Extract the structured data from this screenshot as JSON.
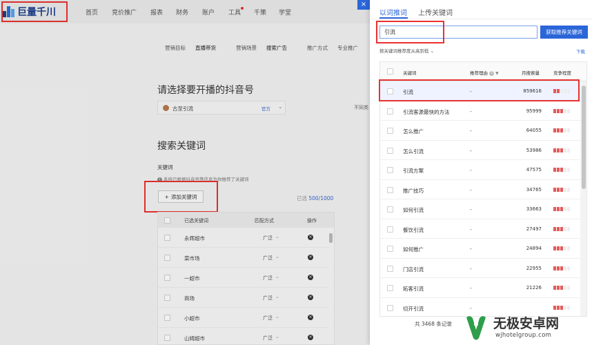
{
  "app": {
    "brand": "巨量千川",
    "nav": [
      "首页",
      "竞价推广",
      "报表",
      "财务",
      "账户",
      "工具",
      "千策",
      "学堂"
    ]
  },
  "subtabs": [
    "营销目标",
    "直播带货",
    "营销场景",
    "搜索广告",
    "推广方式",
    "专业推广"
  ],
  "main": {
    "select_account_title": "请选择要开播的抖音号",
    "account_name": "古至引流",
    "account_badge": "官方",
    "side_text": "不同类",
    "search_kw_title": "搜索关键词",
    "kw_label": "关键词",
    "kw_tip": "系统已根据抖音号等信息为你推荐了关键词",
    "add_kw_button": "添加关键词",
    "add_kw_plus": "+",
    "selected_prefix": "已选",
    "selected_value": "500/1000",
    "table_headers": {
      "keyword": "已选关键词",
      "match": "匹配方式",
      "action": "操作"
    },
    "rows": [
      {
        "kw": "永辉超市",
        "match": "广泛"
      },
      {
        "kw": "菜市场",
        "match": "广泛"
      },
      {
        "kw": "一超市",
        "match": "广泛"
      },
      {
        "kw": "商场",
        "match": "广泛"
      },
      {
        "kw": "小超市",
        "match": "广泛"
      },
      {
        "kw": "山姆超市",
        "match": "广泛"
      }
    ]
  },
  "drawer": {
    "tabs": [
      "以词推词",
      "上传关键词"
    ],
    "search_value": "引流",
    "fetch_button": "获取推荐关键词",
    "sort_text": "按关键词推荐度从高到低",
    "download": "下载",
    "headers": {
      "keyword": "关键词",
      "reason": "推荐理由",
      "volume": "月搜索量",
      "competition": "竞争程度"
    },
    "rows": [
      {
        "kw": "引流",
        "reason": "-",
        "volume": "859616",
        "level": 2
      },
      {
        "kw": "引流客源最快的方法",
        "reason": "-",
        "volume": "95999",
        "level": 3
      },
      {
        "kw": "怎么推广",
        "reason": "-",
        "volume": "64055",
        "level": 3
      },
      {
        "kw": "怎么引流",
        "reason": "-",
        "volume": "53986",
        "level": 3
      },
      {
        "kw": "引流方案",
        "reason": "-",
        "volume": "47575",
        "level": 3
      },
      {
        "kw": "推广技巧",
        "reason": "-",
        "volume": "34765",
        "level": 3
      },
      {
        "kw": "如何引流",
        "reason": "-",
        "volume": "33663",
        "level": 3
      },
      {
        "kw": "餐饮引流",
        "reason": "-",
        "volume": "27497",
        "level": 3
      },
      {
        "kw": "如何推广",
        "reason": "-",
        "volume": "24894",
        "level": 3
      },
      {
        "kw": "门店引流",
        "reason": "-",
        "volume": "22955",
        "level": 3
      },
      {
        "kw": "拓客引流",
        "reason": "-",
        "volume": "21226",
        "level": 3
      },
      {
        "kw": "切开引流",
        "reason": "-",
        "volume": "",
        "level": 3
      }
    ],
    "total": "共 3468 条记录"
  },
  "watermark": {
    "title": "无极安卓网",
    "url": "wjhotelgroup.com"
  },
  "colors": {
    "accent": "#2b66d9",
    "highlight": "#e8312f",
    "competition": "#e35a5a"
  }
}
